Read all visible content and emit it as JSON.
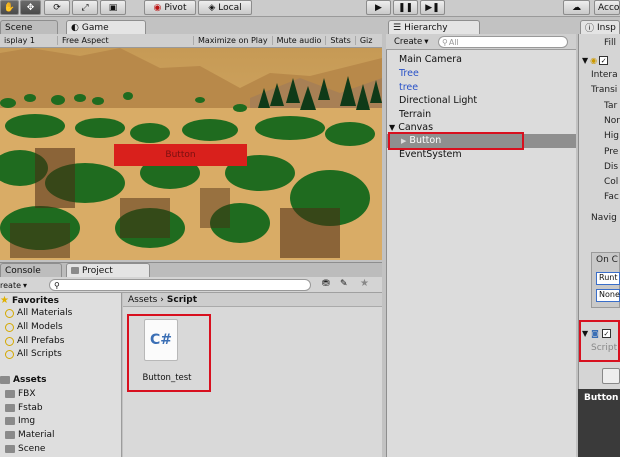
{
  "toolbar": {
    "pivot_label": "Pivot",
    "local_label": "Local",
    "account_label": "Acco"
  },
  "tabs": {
    "scene": "Scene",
    "game": "Game",
    "hierarchy": "Hierarchy",
    "inspector": "Insp",
    "console": "Console",
    "project": "Project"
  },
  "game_toolbar": {
    "display": "isplay 1",
    "aspect": "Free Aspect",
    "maximize": "Maximize on Play",
    "mute": "Mute audio",
    "stats": "Stats",
    "gizmos": "Giz"
  },
  "game_view": {
    "button_label": "Button"
  },
  "hierarchy": {
    "create_label": "Create",
    "search_placeholder": "All",
    "items": [
      {
        "label": "Main Camera",
        "color": "#111111"
      },
      {
        "label": "Tree",
        "color": "#2952c8"
      },
      {
        "label": "tree",
        "color": "#2952c8"
      },
      {
        "label": "Directional Light",
        "color": "#111111"
      },
      {
        "label": "Terrain",
        "color": "#111111"
      },
      {
        "label": "Canvas",
        "color": "#111111"
      },
      {
        "label": "Button",
        "color": "#ffffff"
      },
      {
        "label": "EventSystem",
        "color": "#111111"
      }
    ]
  },
  "inspector": {
    "fill": "Fill",
    "rows": [
      "Intera",
      "Transi",
      "Tar",
      "Nor",
      "Hig",
      "Pre",
      "Dis",
      "Col",
      "Fac",
      "Navig",
      "On C",
      "Runt",
      "None",
      "Script",
      "Button"
    ]
  },
  "project": {
    "create_label": "reate",
    "favorites_label": "Favorites",
    "favorites": [
      "All Materials",
      "All Models",
      "All Prefabs",
      "All Scripts"
    ],
    "assets_label": "Assets",
    "folders": [
      "FBX",
      "Fstab",
      "Img",
      "Material",
      "Scene"
    ],
    "breadcrumb_root": "Assets",
    "breadcrumb_current": "Script",
    "file_name": "Button_test",
    "file_icon_text": "C#"
  },
  "colors": {
    "highlight_red": "#d8101f",
    "selection_gray": "#8f8f8f",
    "link_blue": "#2952c8"
  }
}
